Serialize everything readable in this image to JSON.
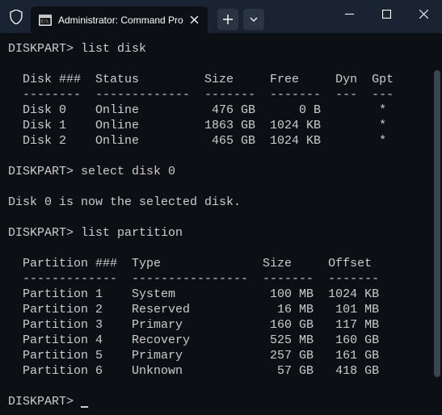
{
  "window": {
    "tab_title": "Administrator: Command Pro"
  },
  "terminal": {
    "prompt": "DISKPART>",
    "cmd_list_disk": "list disk",
    "cmd_select_disk": "select disk 0",
    "cmd_list_partition": "list partition",
    "select_response": "Disk 0 is now the selected disk.",
    "disk_header": "  Disk ###  Status         Size     Free     Dyn  Gpt",
    "disk_divider": "  --------  -------------  -------  -------  ---  ---",
    "disk_rows": [
      "  Disk 0    Online          476 GB      0 B        *",
      "  Disk 1    Online         1863 GB  1024 KB        *",
      "  Disk 2    Online          465 GB  1024 KB        *"
    ],
    "part_header": "  Partition ###  Type              Size     Offset",
    "part_divider": "  -------------  ----------------  -------  -------",
    "part_rows": [
      "  Partition 1    System             100 MB  1024 KB",
      "  Partition 2    Reserved            16 MB   101 MB",
      "  Partition 3    Primary            160 GB   117 MB",
      "  Partition 4    Recovery           525 MB   160 GB",
      "  Partition 5    Primary            257 GB   161 GB",
      "  Partition 6    Unknown             57 GB   418 GB"
    ]
  }
}
